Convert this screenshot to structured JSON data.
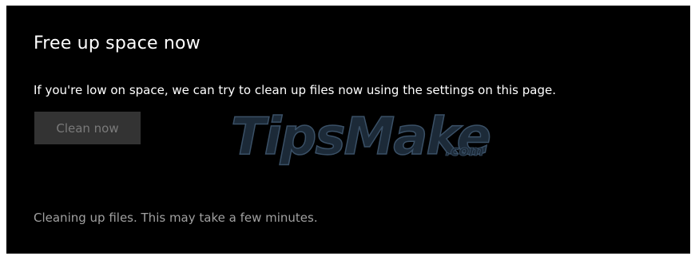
{
  "section": {
    "title": "Free up space now",
    "description": "If you're low on space, we can try to clean up files now using the settings on this page.",
    "clean_button_label": "Clean now",
    "status_text": "Cleaning up files. This may take a few minutes."
  },
  "watermark": {
    "brand": "TipsMake",
    "suffix": ".com"
  },
  "colors": {
    "background": "#000000",
    "button_disabled": "#333333",
    "button_text_disabled": "#7a7a7a",
    "status_text": "#a0a0a0"
  }
}
